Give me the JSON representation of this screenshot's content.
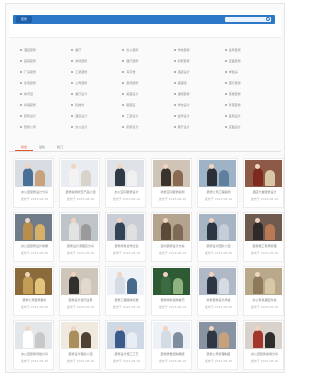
{
  "header": {
    "tag_label": "装修",
    "search_placeholder": ""
  },
  "categories": [
    [
      "酒店装修",
      "餐厅",
      "办公装修",
      "学校装修",
      "会所装修"
    ],
    [
      "医院装修",
      "商场装修",
      "展厅装修",
      "别墅装修",
      "店面装修"
    ],
    [
      "厂房装修",
      "工装装修",
      "写字楼",
      "酒店设计",
      "样板房"
    ],
    [
      "住宅装修",
      "公司装修",
      "卖场装修",
      "美容院",
      "银行装修"
    ],
    [
      "体育馆",
      "餐厅设计",
      "美容设计",
      "酒吧装修",
      "茶楼装修"
    ],
    [
      "商铺装修",
      "售楼处",
      "服装店",
      "学校设计",
      "影院装修"
    ],
    [
      "装修设计",
      "酒店设计",
      "工装设计",
      "会所设计",
      "医院设计"
    ],
    [
      "装修公司",
      "办公设计",
      "别墅设计",
      "展厅设计",
      "店面设计"
    ]
  ],
  "tabs": [
    "综合",
    "最新",
    "热门"
  ],
  "cards": [
    {
      "title": "办公室装修设计分享",
      "date": "发布于 2015-08-16",
      "c1": "#4a6f96",
      "c2": "#c7a27c",
      "bg": "#d8dde4"
    },
    {
      "title": "装修案例欣赏产品介绍",
      "date": "发布于 2015-08-16",
      "c1": "#f3f3f3",
      "c2": "#d9d2c9",
      "bg": "#e9ecf0"
    },
    {
      "title": "办公空间装修设计",
      "date": "发布于 2015-08-16",
      "c1": "#2f3a46",
      "c2": "#f0f0f0",
      "bg": "#dfe3e8"
    },
    {
      "title": "商务空间装修案例",
      "date": "发布于 2015-08-16",
      "c1": "#3a332c",
      "c2": "#8a6a50",
      "bg": "#cfc4b6"
    },
    {
      "title": "装修公司工程案例",
      "date": "发布于 2015-08-16",
      "c1": "#2d2f36",
      "c2": "#5f7f9d",
      "bg": "#9fb3c6"
    },
    {
      "title": "酒店大堂装修设计",
      "date": "发布于 2015-08-16",
      "c1": "#7f2a1f",
      "c2": "#d8c6a6",
      "bg": "#8c5a47"
    },
    {
      "title": "办公室装修设计效果",
      "date": "发布于 2015-08-16",
      "c1": "#b98d4c",
      "c2": "#d9b06a",
      "bg": "#6f7c89"
    },
    {
      "title": "装修设计流程及分享",
      "date": "发布于 2015-08-16",
      "c1": "#e3e3e3",
      "c2": "#9a9a9a",
      "bg": "#bfc4c9"
    },
    {
      "title": "装修商务合作洽谈",
      "date": "发布于 2015-08-16",
      "c1": "#344457",
      "c2": "#e0e0e0",
      "bg": "#c9ced6"
    },
    {
      "title": "室内装修设计方案",
      "date": "发布于 2015-08-16",
      "c1": "#5b4a3a",
      "c2": "#7e6a55",
      "bg": "#b4a38e"
    },
    {
      "title": "装修设计团队介绍",
      "date": "发布于 2015-08-16",
      "c1": "#2b3542",
      "c2": "#c4cdd8",
      "bg": "#a6b4c4"
    },
    {
      "title": "装修施工现场管理",
      "date": "发布于 2015-08-16",
      "c1": "#2f2a2a",
      "c2": "#b77a55",
      "bg": "#6e5a4f"
    },
    {
      "title": "装修公司装修报价",
      "date": "发布于 2015-08-16",
      "c1": "#c29b55",
      "c2": "#e2c47c",
      "bg": "#8b6a3c"
    },
    {
      "title": "装修设计合同注意",
      "date": "发布于 2015-08-16",
      "c1": "#32302e",
      "c2": "#e2d8ce",
      "bg": "#cfc6bb"
    },
    {
      "title": "装修工程验收标准",
      "date": "发布于 2015-08-16",
      "c1": "#d6dce4",
      "c2": "#47698c",
      "bg": "#eef1f5"
    },
    {
      "title": "装修材料选购技巧",
      "date": "发布于 2015-08-16",
      "c1": "#3c6b41",
      "c2": "#8fb27e",
      "bg": "#2f5b34"
    },
    {
      "title": "商务装修设计风格",
      "date": "发布于 2015-08-16",
      "c1": "#2e3542",
      "c2": "#d7dbe2",
      "bg": "#aeb8c6"
    },
    {
      "title": "办公家具搭配方案",
      "date": "发布于 2015-08-16",
      "c1": "#8c7a5a",
      "c2": "#d8c9a6",
      "bg": "#b9a889"
    },
    {
      "title": "办公室装修风格分享",
      "date": "发布于 2015-08-16",
      "c1": "#ffffff",
      "c2": "#c8c8c8",
      "bg": "#e4e7ea"
    },
    {
      "title": "装修设计理念介绍",
      "date": "发布于 2015-08-16",
      "c1": "#aa8f5c",
      "c2": "#4e4232",
      "bg": "#efe9df"
    },
    {
      "title": "装修设计施工工艺",
      "date": "发布于 2015-08-16",
      "c1": "#3b5b8a",
      "c2": "#e9eef4",
      "bg": "#cfd9e6"
    },
    {
      "title": "装修质量控制措施",
      "date": "发布于 2015-08-16",
      "c1": "#d5dbe2",
      "c2": "#7e8e9f",
      "bg": "#eef2f6"
    },
    {
      "title": "装修公司管理制度",
      "date": "发布于 2015-08-16",
      "c1": "#2f3644",
      "c2": "#c6a17b",
      "bg": "#8894a4"
    },
    {
      "title": "办公室装修案例分享",
      "date": "发布于 2015-08-16",
      "c1": "#a3362a",
      "c2": "#2d2d2d",
      "bg": "#d9d2cc"
    }
  ]
}
